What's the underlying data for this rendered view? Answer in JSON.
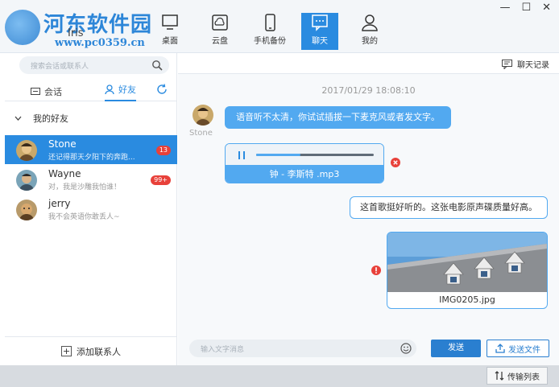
{
  "watermark": {
    "title": "河东软件园",
    "url": "www.pc0359.cn"
  },
  "user": {
    "name": "Iris"
  },
  "nav": [
    {
      "label": "桌面",
      "icon": "desktop-icon"
    },
    {
      "label": "云盘",
      "icon": "cloud-disk-icon"
    },
    {
      "label": "手机备份",
      "icon": "phone-icon"
    },
    {
      "label": "聊天",
      "icon": "chat-icon",
      "active": true
    },
    {
      "label": "我的",
      "icon": "user-icon"
    }
  ],
  "window_controls": {
    "minimize": "—",
    "maximize": "☐",
    "close": "✕"
  },
  "sidebar": {
    "search_placeholder": "搜索会话或联系人",
    "tabs": {
      "chat": "会话",
      "friends": "好友"
    },
    "group": "我的好友",
    "contacts": [
      {
        "name": "Stone",
        "preview": "还记得那天夕阳下的奔跑...",
        "badge": "13",
        "selected": true
      },
      {
        "name": "Wayne",
        "preview": "对，我是沙雕我怕谁！",
        "badge": "99+"
      },
      {
        "name": "jerry",
        "preview": "我不会英语你敢丢人~",
        "badge": ""
      }
    ],
    "add_contact": "添加联系人"
  },
  "chat": {
    "history_label": "聊天记录",
    "timestamp": "2017/01/29  18:08:10",
    "sender_name": "Stone",
    "message_1": "语音听不太清，你试试插拔一下麦克风或者发文字。",
    "audio": {
      "filename": "钟 - 李斯特 .mp3",
      "progress": 0.38
    },
    "message_2": "这首歌挺好听的。这张电影原声碟质量好高。",
    "image_caption": "IMG0205.jpg",
    "input_placeholder": "输入文字消息",
    "send_label": "发送",
    "send_file_label": "发送文件"
  },
  "footer": {
    "transfer_label": "传输列表"
  },
  "colors": {
    "accent": "#2a8be0",
    "bubble": "#52a9f0",
    "badge": "#e8413a"
  }
}
